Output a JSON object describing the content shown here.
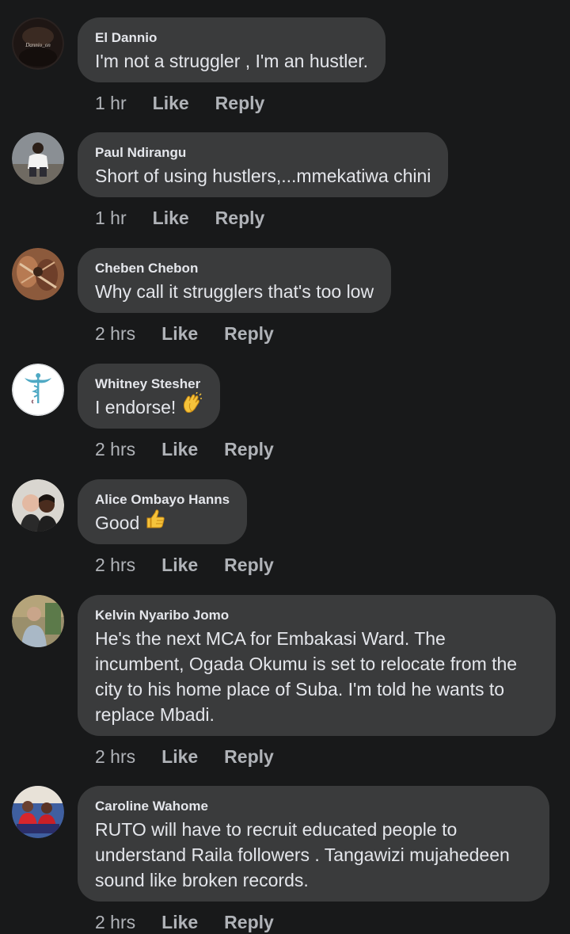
{
  "comments": [
    {
      "name": "El Dannio",
      "text": "I'm not a struggler , I'm an hustler.",
      "time": "1 hr",
      "like_label": "Like",
      "reply_label": "Reply",
      "avatar_icon": "profile-photo",
      "avatar_overlay_text": "Dannio_on"
    },
    {
      "name": "Paul Ndirangu",
      "text": "Short of using hustlers,...mmekatiwa chini",
      "time": "1 hr",
      "like_label": "Like",
      "reply_label": "Reply",
      "avatar_icon": "profile-photo"
    },
    {
      "name": "Cheben Chebon",
      "text": "Why call it strugglers that's too low",
      "time": "2 hrs",
      "like_label": "Like",
      "reply_label": "Reply",
      "avatar_icon": "profile-photo"
    },
    {
      "name": "Whitney Stesher",
      "text": "I endorse!",
      "emoji": "clapping-hands-emoji",
      "time": "2 hrs",
      "like_label": "Like",
      "reply_label": "Reply",
      "avatar_icon": "caduceus-logo"
    },
    {
      "name": "Alice Ombayo Hanns",
      "text": "Good",
      "emoji": "thumbs-up-emoji",
      "time": "2 hrs",
      "like_label": "Like",
      "reply_label": "Reply",
      "avatar_icon": "profile-photo"
    },
    {
      "name": "Kelvin Nyaribo Jomo",
      "text": "He's the next MCA for Embakasi Ward. The incumbent, Ogada Okumu is set to relocate from the city to his home place of Suba. I'm told he wants to replace Mbadi.",
      "time": "2 hrs",
      "like_label": "Like",
      "reply_label": "Reply",
      "avatar_icon": "profile-photo"
    },
    {
      "name": "Caroline Wahome",
      "text": "RUTO will have to recruit educated people to understand Raila followers . Tangawizi mujahedeen sound like broken records.",
      "time": "2 hrs",
      "like_label": "Like",
      "reply_label": "Reply",
      "avatar_icon": "profile-photo"
    }
  ],
  "colors": {
    "background": "#18191a",
    "bubble": "#3a3b3c",
    "primary_text": "#e4e6eb",
    "secondary_text": "#b0b3b8"
  }
}
